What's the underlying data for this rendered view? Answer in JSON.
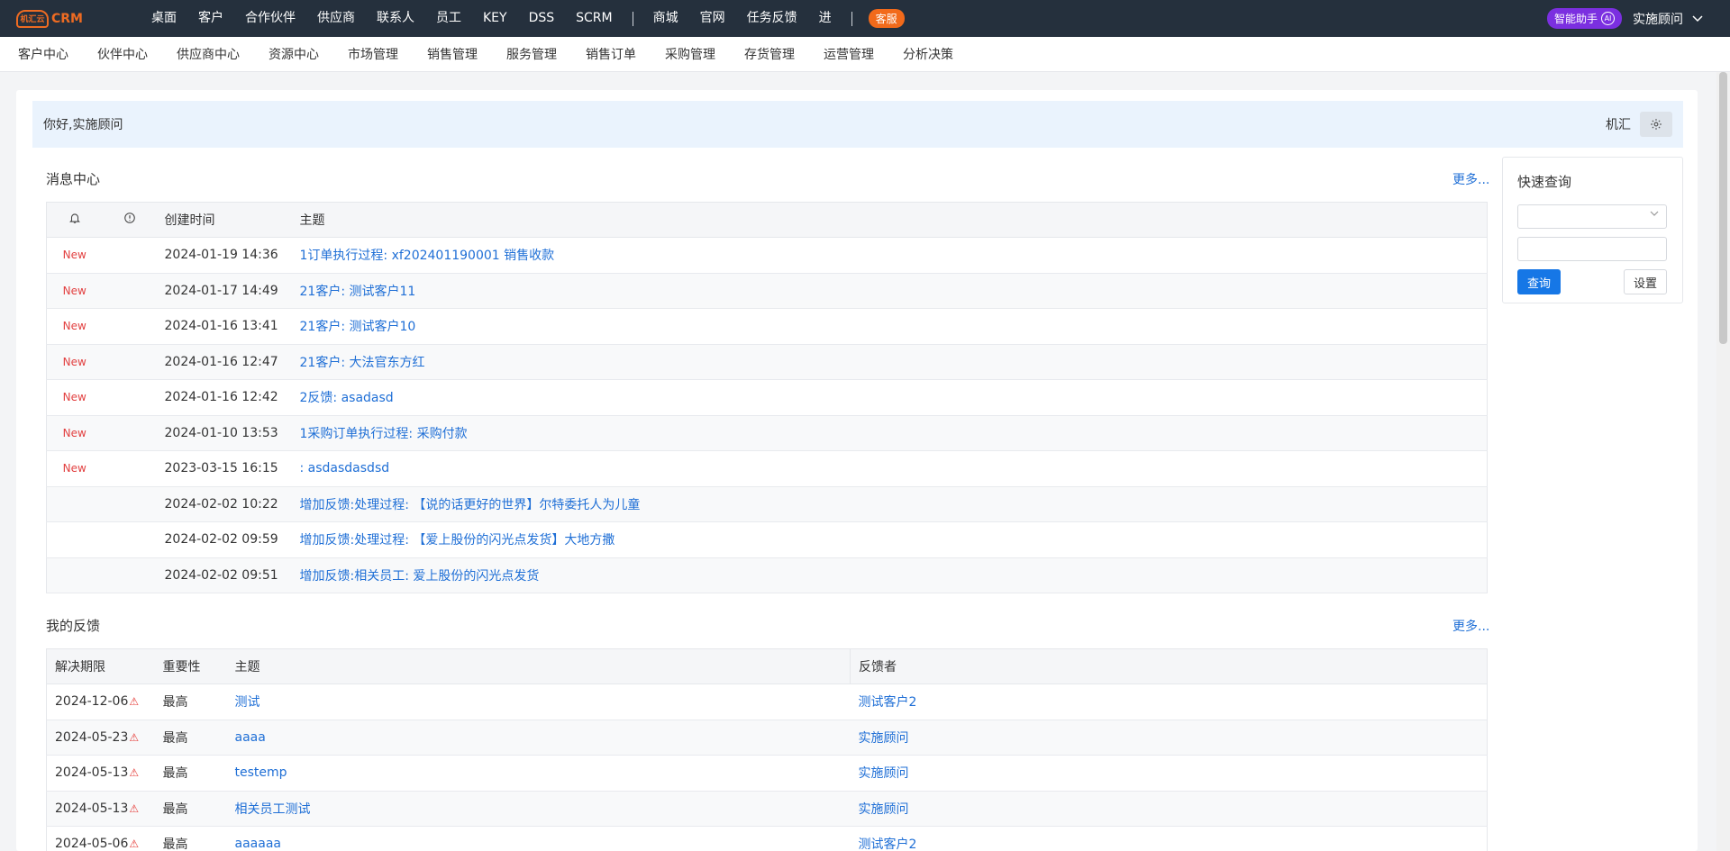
{
  "app": {
    "logo_badge": "机汇云",
    "logo_text": "CRM"
  },
  "topnav": {
    "items": [
      "桌面",
      "客户",
      "合作伙伴",
      "供应商",
      "联系人",
      "员工",
      "KEY",
      "DSS",
      "SCRM"
    ],
    "items2": [
      "商城",
      "官网",
      "任务反馈",
      "进"
    ],
    "service": "客服"
  },
  "topright": {
    "ai_label": "智能助手",
    "ai_badge": "AI",
    "user": "实施顾问"
  },
  "subnav": [
    "客户中心",
    "伙伴中心",
    "供应商中心",
    "资源中心",
    "市场管理",
    "销售管理",
    "服务管理",
    "销售订单",
    "采购管理",
    "存货管理",
    "运营管理",
    "分析决策"
  ],
  "welcome": {
    "greeting": "你好,实施顾问",
    "org": "机汇"
  },
  "messages": {
    "title": "消息中心",
    "more": "更多...",
    "headers": {
      "created": "创建时间",
      "subject": "主题"
    },
    "rows": [
      {
        "flag": "New",
        "time": "2024-01-19 14:36",
        "subject": "1订单执行过程: xf202401190001 销售收款"
      },
      {
        "flag": "New",
        "time": "2024-01-17 14:49",
        "subject": "21客户: 测试客户11"
      },
      {
        "flag": "New",
        "time": "2024-01-16 13:41",
        "subject": "21客户: 测试客户10"
      },
      {
        "flag": "New",
        "time": "2024-01-16 12:47",
        "subject": "21客户: 大法官东方红"
      },
      {
        "flag": "New",
        "time": "2024-01-16 12:42",
        "subject": "2反馈: asadasd"
      },
      {
        "flag": "New",
        "time": "2024-01-10 13:53",
        "subject": "1采购订单执行过程: 采购付款"
      },
      {
        "flag": "New",
        "time": "2023-03-15 16:15",
        "subject": ": asdasdasdsd"
      },
      {
        "flag": "",
        "time": "2024-02-02 10:22",
        "subject": "增加反馈:处理过程: 【说的话更好的世界】尔特委托人为儿童"
      },
      {
        "flag": "",
        "time": "2024-02-02 09:59",
        "subject": "增加反馈:处理过程: 【爱上股份的闪光点发货】大地方撒"
      },
      {
        "flag": "",
        "time": "2024-02-02 09:51",
        "subject": "增加反馈:相关员工: 爱上股份的闪光点发货"
      }
    ]
  },
  "feedback": {
    "title": "我的反馈",
    "more": "更多...",
    "headers": {
      "deadline": "解决期限",
      "importance": "重要性",
      "subject": "主题",
      "reporter": "反馈者"
    },
    "rows": [
      {
        "deadline": "2024-12-06",
        "importance": "最高",
        "subject": "测试",
        "reporter": "测试客户2"
      },
      {
        "deadline": "2024-05-23",
        "importance": "最高",
        "subject": "aaaa",
        "reporter": "实施顾问"
      },
      {
        "deadline": "2024-05-13",
        "importance": "最高",
        "subject": "testemp",
        "reporter": "实施顾问"
      },
      {
        "deadline": "2024-05-13",
        "importance": "最高",
        "subject": "相关员工测试",
        "reporter": "实施顾问"
      },
      {
        "deadline": "2024-05-06",
        "importance": "最高",
        "subject": "aaaaaa",
        "reporter": "测试客户2"
      }
    ]
  },
  "quick": {
    "title": "快速查询",
    "query_btn": "查询",
    "settings_btn": "设置"
  }
}
